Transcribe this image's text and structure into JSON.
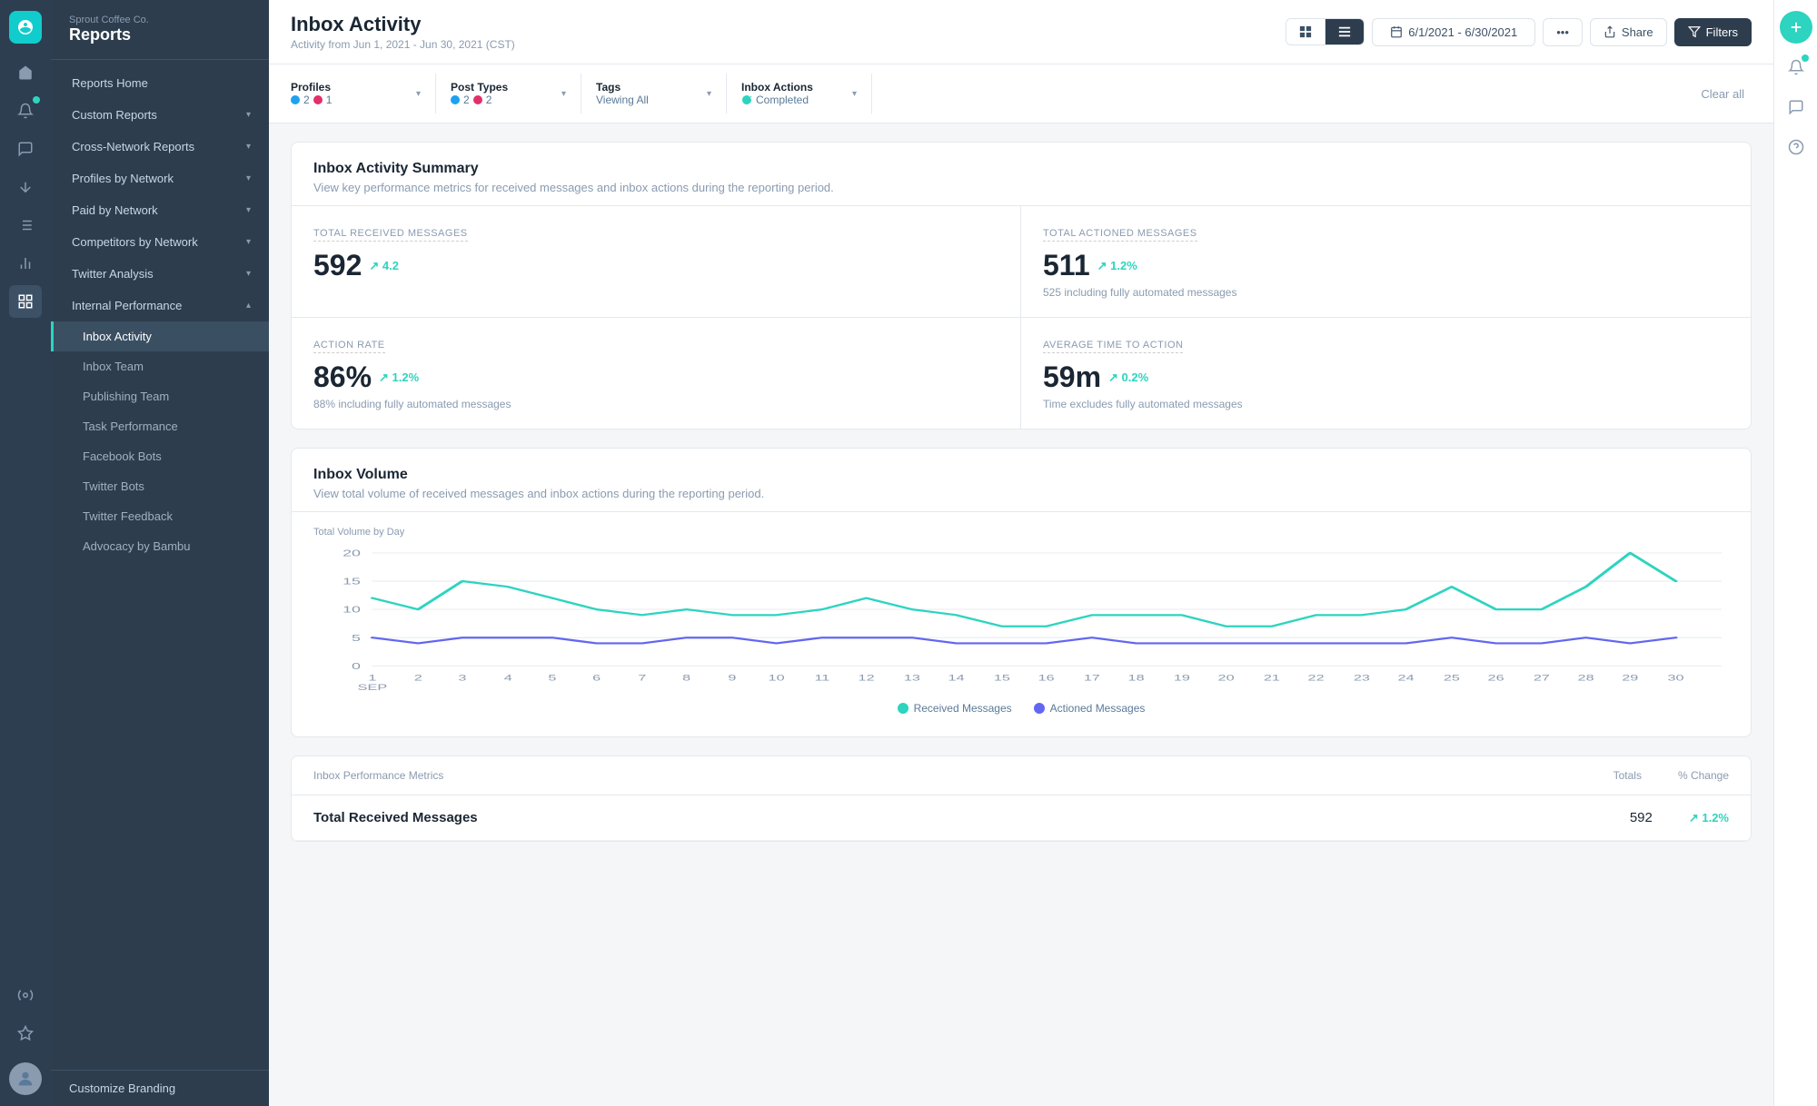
{
  "app": {
    "company": "Sprout Coffee Co.",
    "section": "Reports"
  },
  "sidebar": {
    "main_nav": [
      {
        "id": "reports-home",
        "label": "Reports Home",
        "expandable": false
      },
      {
        "id": "custom-reports",
        "label": "Custom Reports",
        "expandable": true
      },
      {
        "id": "cross-network",
        "label": "Cross-Network Reports",
        "expandable": true
      },
      {
        "id": "profiles-by-network",
        "label": "Profiles by Network",
        "expandable": true
      },
      {
        "id": "paid-by-network",
        "label": "Paid by Network",
        "expandable": true
      },
      {
        "id": "competitors-by-network",
        "label": "Competitors by Network",
        "expandable": true
      },
      {
        "id": "twitter-analysis",
        "label": "Twitter Analysis",
        "expandable": true
      },
      {
        "id": "internal-performance",
        "label": "Internal Performance",
        "expandable": true,
        "expanded": true
      }
    ],
    "sub_items": [
      {
        "id": "inbox-activity",
        "label": "Inbox Activity",
        "active": true
      },
      {
        "id": "inbox-team",
        "label": "Inbox Team"
      },
      {
        "id": "publishing-team",
        "label": "Publishing Team"
      },
      {
        "id": "task-performance",
        "label": "Task Performance"
      },
      {
        "id": "facebook-bots",
        "label": "Facebook Bots"
      },
      {
        "id": "twitter-bots",
        "label": "Twitter Bots"
      },
      {
        "id": "twitter-feedback",
        "label": "Twitter Feedback"
      },
      {
        "id": "advocacy-by-bambu",
        "label": "Advocacy by Bambu"
      }
    ],
    "footer": "Customize Branding"
  },
  "page": {
    "title": "Inbox Activity",
    "subtitle": "Activity from Jun 1, 2021 - Jun 30, 2021 (CST)"
  },
  "toolbar": {
    "grid_view_label": "⊞",
    "list_view_label": "≡",
    "date_range": "6/1/2021 - 6/30/2021",
    "more_label": "•••",
    "share_label": "Share",
    "filters_label": "Filters"
  },
  "filters": {
    "profiles": {
      "label": "Profiles",
      "twitter_count": "2",
      "instagram_count": "1"
    },
    "post_types": {
      "label": "Post Types",
      "twitter_count": "2",
      "instagram_count": "2"
    },
    "tags": {
      "label": "Tags",
      "value": "Viewing All"
    },
    "inbox_actions": {
      "label": "Inbox Actions",
      "value": "Completed"
    },
    "clear_all": "Clear all"
  },
  "summary": {
    "section_title": "Inbox Activity Summary",
    "section_subtitle": "View key performance metrics for received messages and inbox actions during the reporting period.",
    "metrics": [
      {
        "label": "Total Received Messages",
        "value": "592",
        "trend": "↗ 4.2",
        "trend_positive": true,
        "sub_text": ""
      },
      {
        "label": "Total Actioned Messages",
        "value": "511",
        "trend": "↗ 1.2%",
        "trend_positive": true,
        "sub_text": "525 including fully automated messages"
      },
      {
        "label": "Action Rate",
        "value": "86%",
        "trend": "↗ 1.2%",
        "trend_positive": true,
        "sub_text": "88% including fully automated messages"
      },
      {
        "label": "Average Time to Action",
        "value": "59m",
        "trend": "↗ 0.2%",
        "trend_positive": true,
        "sub_text": "Time excludes fully automated messages"
      }
    ]
  },
  "volume": {
    "section_title": "Inbox Volume",
    "section_subtitle": "View total volume of received messages and inbox actions during the reporting period.",
    "chart_label": "Total Volume by Day",
    "y_axis": [
      20,
      15,
      10,
      5,
      0
    ],
    "x_axis": [
      "1",
      "2",
      "3",
      "4",
      "5",
      "6",
      "7",
      "8",
      "9",
      "10",
      "11",
      "12",
      "13",
      "14",
      "15",
      "16",
      "17",
      "18",
      "19",
      "20",
      "21",
      "22",
      "23",
      "24",
      "25",
      "26",
      "27",
      "28",
      "29",
      "30"
    ],
    "x_label": "SEP",
    "legend": [
      {
        "label": "Received Messages",
        "color": "#2dd4bf"
      },
      {
        "label": "Actioned Messages",
        "color": "#6366f1"
      }
    ],
    "received_data": [
      13,
      11,
      15,
      14,
      12,
      11,
      10,
      11,
      10,
      10,
      11,
      12,
      11,
      10,
      9,
      9,
      10,
      10,
      10,
      9,
      9,
      10,
      10,
      11,
      14,
      11,
      11,
      14,
      20,
      15
    ],
    "actioned_data": [
      6,
      5,
      6,
      6,
      6,
      5,
      5,
      6,
      6,
      5,
      6,
      6,
      6,
      5,
      5,
      5,
      6,
      5,
      5,
      5,
      5,
      5,
      5,
      5,
      6,
      5,
      5,
      6,
      5,
      6
    ]
  },
  "performance_table": {
    "title": "Inbox Performance Metrics",
    "col_totals": "Totals",
    "col_change": "% Change",
    "rows": [
      {
        "label": "Total Received Messages",
        "total": "592",
        "change": "↗ 1.2%",
        "positive": true
      }
    ]
  }
}
